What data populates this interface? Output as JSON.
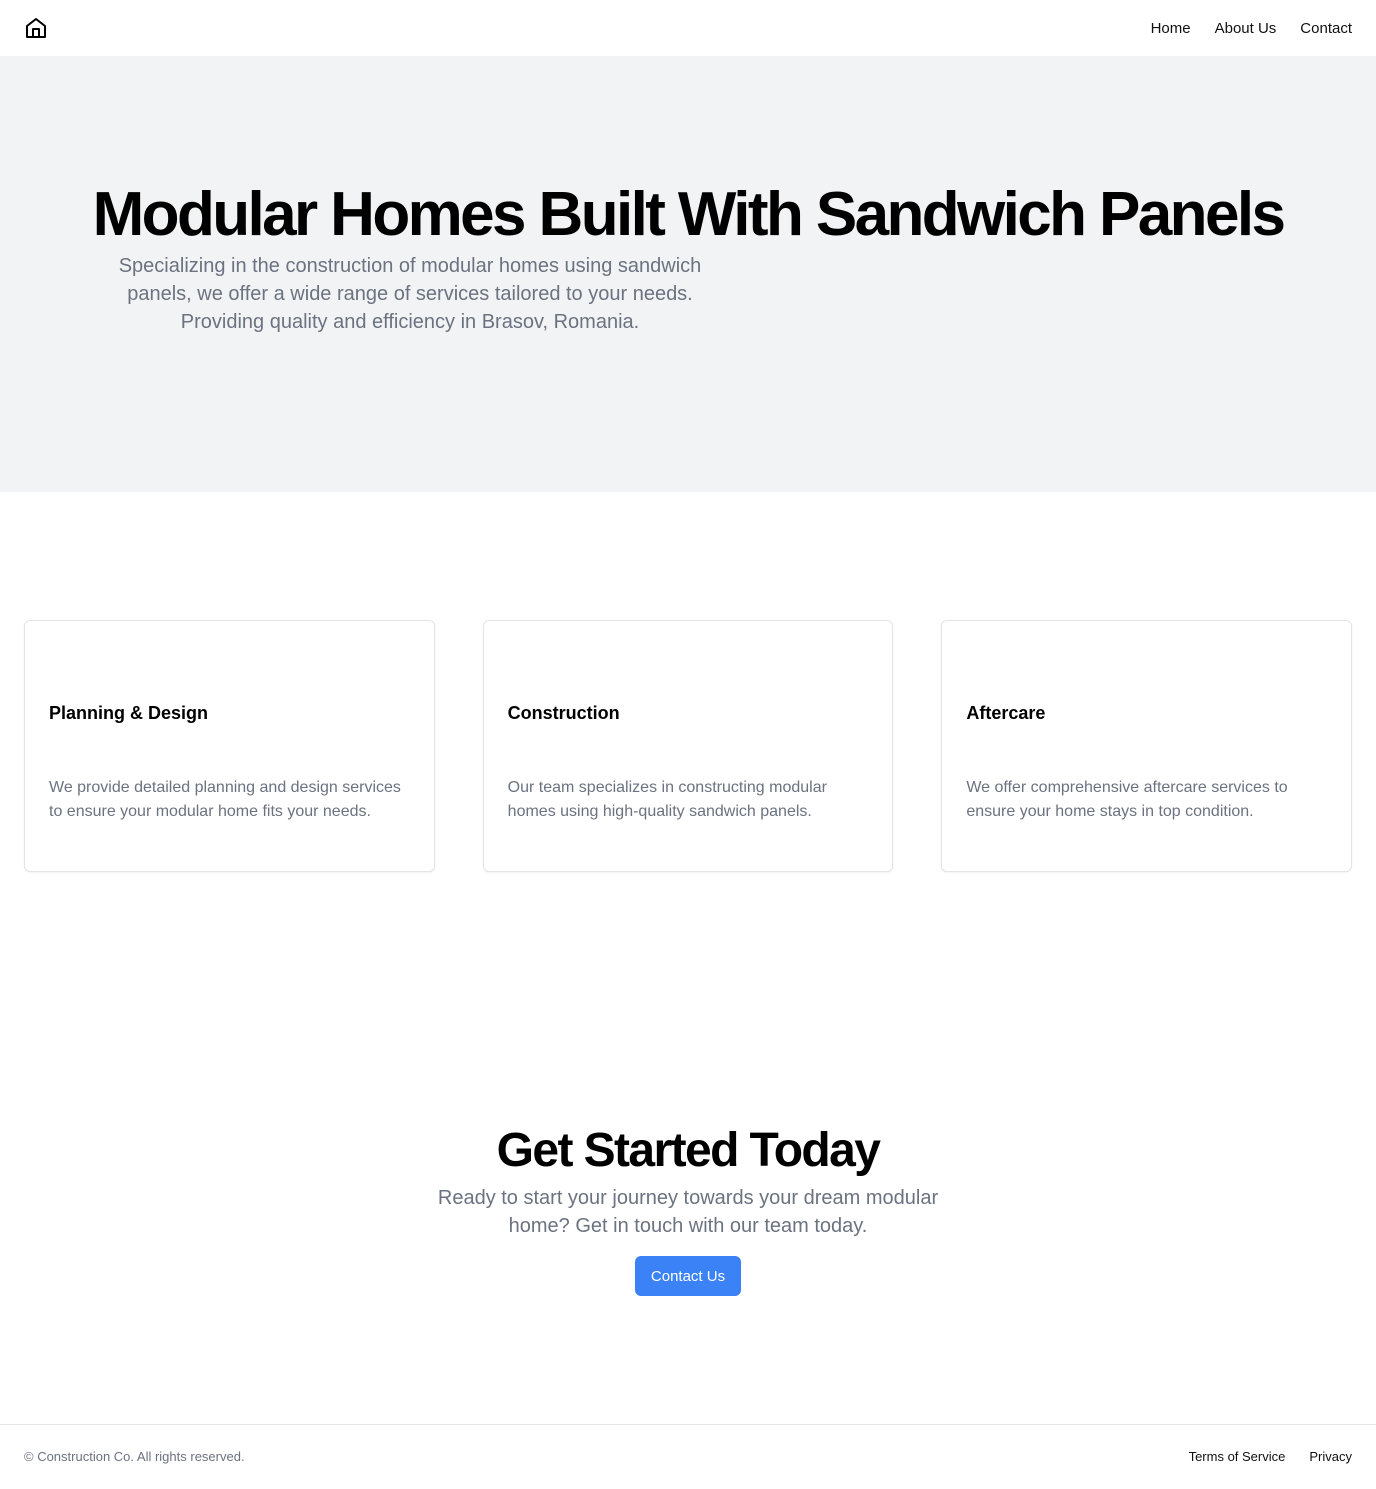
{
  "header": {
    "logo_icon": "home-icon",
    "nav": [
      "Home",
      "About Us",
      "Contact"
    ]
  },
  "hero": {
    "title": "Modular Homes Built With Sandwich Panels",
    "subtitle": "Specializing in the construction of modular homes using sandwich panels, we offer a wide range of services tailored to your needs. Providing quality and efficiency in Brasov, Romania."
  },
  "services": [
    {
      "title": "Planning & Design",
      "text": "We provide detailed planning and design services to ensure your modular home fits your needs."
    },
    {
      "title": "Construction",
      "text": "Our team specializes in constructing modular homes using high-quality sandwich panels."
    },
    {
      "title": "Aftercare",
      "text": "We offer comprehensive aftercare services to ensure your home stays in top condition."
    }
  ],
  "cta": {
    "title": "Get Started Today",
    "subtitle": "Ready to start your journey towards your dream modular home? Get in touch with our team today.",
    "button": "Contact Us"
  },
  "footer": {
    "copyright": "© Construction Co. All rights reserved.",
    "links": [
      "Terms of Service",
      "Privacy"
    ]
  },
  "colors": {
    "hero_bg": "#f2f3f5",
    "accent": "#3b82f6",
    "muted_text": "#6b7280"
  }
}
